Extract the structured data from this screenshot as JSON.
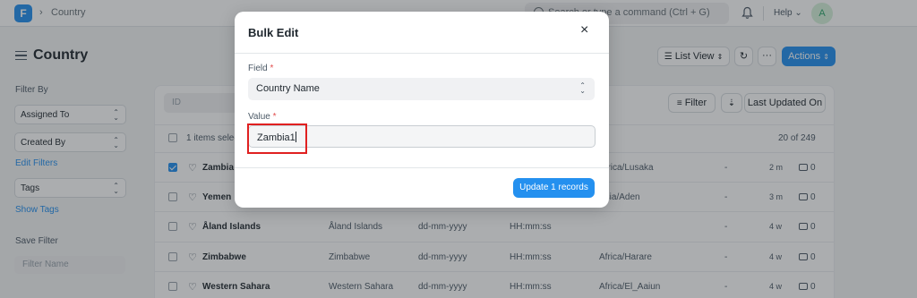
{
  "navbar": {
    "logo": "F",
    "breadcrumb_sep": "›",
    "breadcrumb": "Country",
    "search_placeholder": "Search or type a command (Ctrl + G)",
    "help": "Help ⌄",
    "avatar": "A"
  },
  "page": {
    "title": "Country",
    "list_view": "List View",
    "more": "···",
    "actions": "Actions"
  },
  "sidebar": {
    "filter_by": "Filter By",
    "assigned_to": "Assigned To",
    "created_by": "Created By",
    "edit_filters": "Edit Filters",
    "tags": "Tags",
    "show_tags": "Show Tags",
    "save_filter": "Save Filter",
    "filter_name_placeholder": "Filter Name"
  },
  "list": {
    "id_placeholder": "ID",
    "filter": "Filter",
    "sort": "Last Updated On",
    "items_selected": "1 items selected",
    "count": "20 of 249",
    "rows": [
      {
        "name": "Zambia",
        "col2": "",
        "col3": "",
        "col4": "",
        "tz": "Africa/Lusaka",
        "dash": "-",
        "modified": "2 m",
        "comments": "0",
        "checked": true
      },
      {
        "name": "Yemen",
        "col2": "",
        "col3": "",
        "col4": "",
        "tz": "Asia/Aden",
        "dash": "-",
        "modified": "3 m",
        "comments": "0",
        "checked": false
      },
      {
        "name": "Åland Islands",
        "col2": "Åland Islands",
        "col3": "dd-mm-yyyy",
        "col4": "HH:mm:ss",
        "tz": "",
        "dash": "-",
        "modified": "4 w",
        "comments": "0",
        "checked": false
      },
      {
        "name": "Zimbabwe",
        "col2": "Zimbabwe",
        "col3": "dd-mm-yyyy",
        "col4": "HH:mm:ss",
        "tz": "Africa/Harare",
        "dash": "-",
        "modified": "4 w",
        "comments": "0",
        "checked": false
      },
      {
        "name": "Western Sahara",
        "col2": "Western Sahara",
        "col3": "dd-mm-yyyy",
        "col4": "HH:mm:ss",
        "tz": "Africa/El_Aaiun",
        "dash": "-",
        "modified": "4 w",
        "comments": "0",
        "checked": false
      }
    ]
  },
  "modal": {
    "title": "Bulk Edit",
    "close": "×",
    "field_label": "Field",
    "field_value": "Country Name",
    "value_label": "Value",
    "value_input": "Zambia1",
    "required_mark": "*",
    "update_button": "Update 1 records"
  }
}
